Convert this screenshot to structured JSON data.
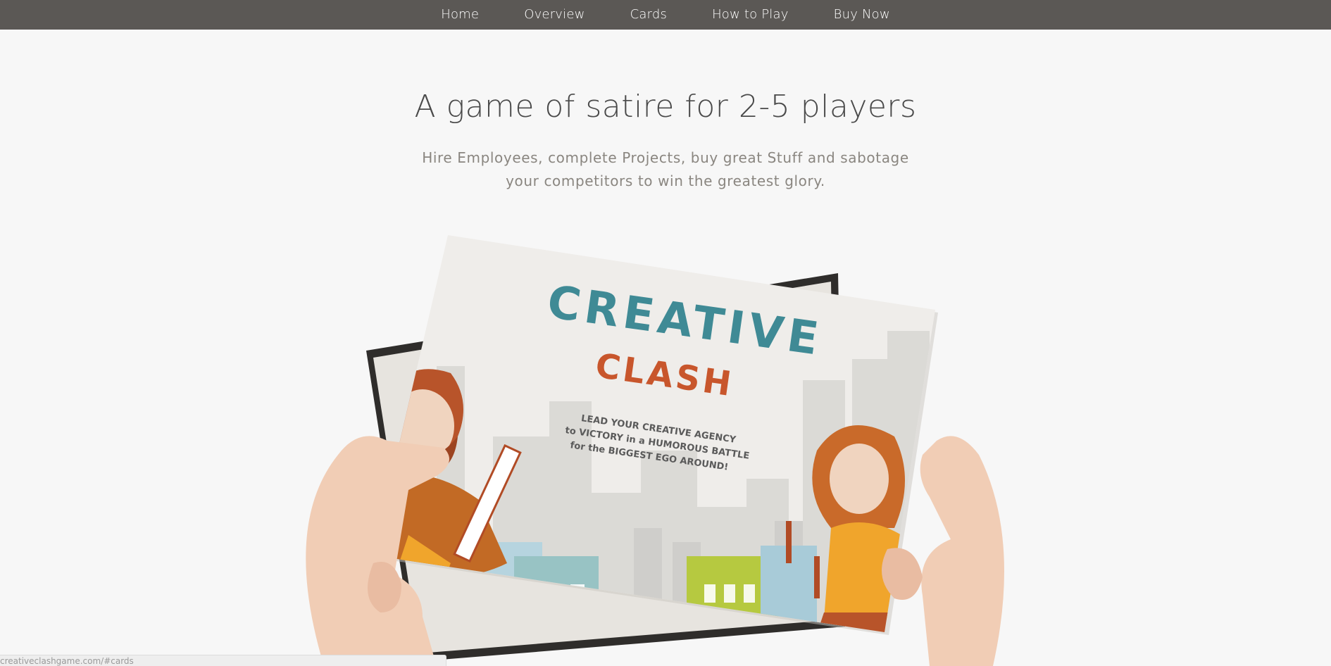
{
  "nav": {
    "items": [
      {
        "label": "Home"
      },
      {
        "label": "Overview"
      },
      {
        "label": "Cards"
      },
      {
        "label": "How to Play"
      },
      {
        "label": "Buy Now"
      }
    ]
  },
  "hero": {
    "title": "A game of satire for 2-5 players",
    "subtitle_line1": "Hire Employees, complete Projects, buy great Stuff and sabotage",
    "subtitle_line2": "your competitors to win the greatest glory."
  },
  "product": {
    "box_title_1": "CREATIVE",
    "box_title_2": "CLASH",
    "tagline_1": "LEAD YOUR CREATIVE AGENCY",
    "tagline_2": "to VICTORY in a HUMOROUS BATTLE",
    "tagline_3": "for the BIGGEST EGO AROUND!"
  },
  "status_bar": {
    "url": "creativeclashgame.com/#cards"
  },
  "colors": {
    "nav_bg": "#5b5855",
    "page_bg": "#f7f7f7",
    "title": "#4a4a4a",
    "subtitle": "#8a8680",
    "accent_orange": "#c8562c"
  }
}
